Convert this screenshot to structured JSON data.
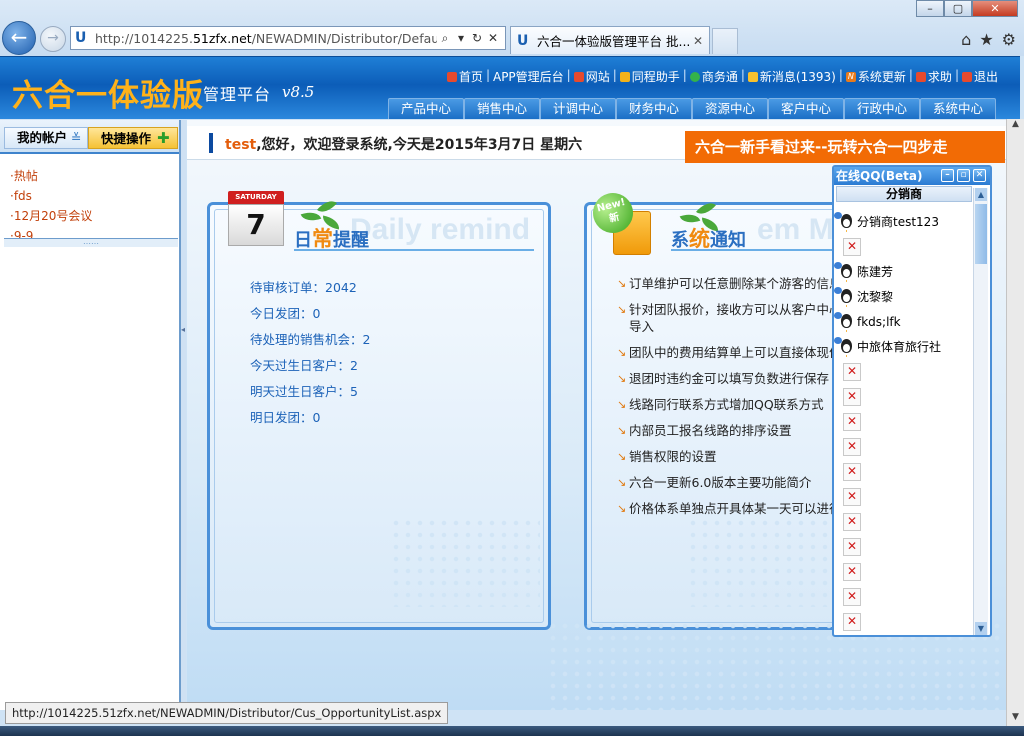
{
  "browser": {
    "url_host": "http://1014225.",
    "url_domain": "51zfx.net",
    "url_path": "/NEWADMIN/Distributor/Default.a",
    "tab_title": "六合一体验版管理平台 批...",
    "status_url": "http://1014225.51zfx.net/NEWADMIN/Distributor/Cus_OpportunityList.aspx",
    "win_min": "–",
    "win_max": "▢",
    "win_close": "✕",
    "back": "←",
    "forward": "→",
    "home": "⌂",
    "fav": "★",
    "settings": "⚙",
    "tab_close": "✕"
  },
  "header": {
    "brand": "六合一体验版",
    "subtitle": "管理平台",
    "version": "v8.5",
    "links": [
      {
        "label": "首页",
        "color": "#e64a2e"
      },
      {
        "label": "APP管理后台",
        "color": ""
      },
      {
        "label": "网站",
        "color": "#e64a2e"
      },
      {
        "label": "同程助手",
        "color": "#f2b21a"
      },
      {
        "label": "商务通",
        "color": "#34b24a"
      },
      {
        "label": "新消息(1393)",
        "color": "#f7c12e"
      },
      {
        "label": "系统更新",
        "color": "#e87a1c"
      },
      {
        "label": "求助",
        "color": "#e64a2e"
      },
      {
        "label": "退出",
        "color": "#e64a2e"
      }
    ],
    "menu": [
      "产品中心",
      "销售中心",
      "计调中心",
      "财务中心",
      "资源中心",
      "客户中心",
      "行政中心",
      "系统中心"
    ]
  },
  "sidebar": {
    "account_label": "我的帐户",
    "account_arrow": "≚",
    "quick_label": "快捷操作",
    "quick_plus": "✚",
    "items": [
      "·热帖",
      "·fds",
      "·12月20号会议",
      "·9-9"
    ],
    "collapse_dots": "……"
  },
  "welcome": {
    "user": "test",
    "message": ",您好，欢迎登录系统,今天是2015年3月7日  星期六",
    "promo": "六合一新手看过来--玩转六合一四步走"
  },
  "daily": {
    "cal_day": "SATURDAY",
    "cal_date": "7",
    "title_pre": "日",
    "title_hl": "常",
    "title_post": "提醒",
    "ghost": "Daily remind",
    "items": [
      "待审核订单：2042",
      "今日发团：0",
      "待处理的销售机会：2",
      "今天过生日客户：2",
      "明天过生日客户：5",
      "明日发团：0"
    ]
  },
  "notice": {
    "badge_en": "New!",
    "badge_cn": "新",
    "title_pre": "系",
    "title_hl": "统",
    "title_post": "通知",
    "ghost": "em Me",
    "items": [
      "订单维护可以任意删除某个游客的信息",
      "针对团队报价，接收方可以从客户中心导入",
      "团队中的费用结算单上可以直接体现价",
      "退团时违约金可以填写负数进行保存",
      "线路同行联系方式增加QQ联系方式",
      "内部员工报名线路的排序设置",
      "销售权限的设置",
      "六合一更新6.0版本主要功能简介",
      "价格体系单独点开具体某一天可以进行",
      ""
    ]
  },
  "qq": {
    "title": "在线QQ(Beta)",
    "group": "分销商",
    "btn_min": "–",
    "btn_max": "▫",
    "btn_close": "✕",
    "scroll_up": "▲",
    "scroll_down": "▼",
    "rows": [
      {
        "type": "contact",
        "name": "分销商test123"
      },
      {
        "type": "broken",
        "name": "✕"
      },
      {
        "type": "contact",
        "name": "陈建芳"
      },
      {
        "type": "contact",
        "name": "沈黎黎"
      },
      {
        "type": "contact",
        "name": "fkds;lfk"
      },
      {
        "type": "contact",
        "name": "中旅体育旅行社"
      },
      {
        "type": "broken",
        "name": "✕"
      },
      {
        "type": "broken",
        "name": "✕"
      },
      {
        "type": "broken",
        "name": "✕"
      },
      {
        "type": "broken",
        "name": "✕"
      },
      {
        "type": "broken",
        "name": "✕"
      },
      {
        "type": "broken",
        "name": "✕"
      },
      {
        "type": "broken",
        "name": "✕"
      },
      {
        "type": "broken",
        "name": "✕"
      },
      {
        "type": "broken",
        "name": "✕"
      },
      {
        "type": "broken",
        "name": "✕"
      },
      {
        "type": "broken",
        "name": "✕"
      }
    ]
  },
  "colors": {
    "brand": "#ffb21a",
    "header_blue": "#0c5db8",
    "promo": "#f26b05",
    "link_orange": "#c2410c",
    "reminder_blue": "#1d63b8"
  }
}
